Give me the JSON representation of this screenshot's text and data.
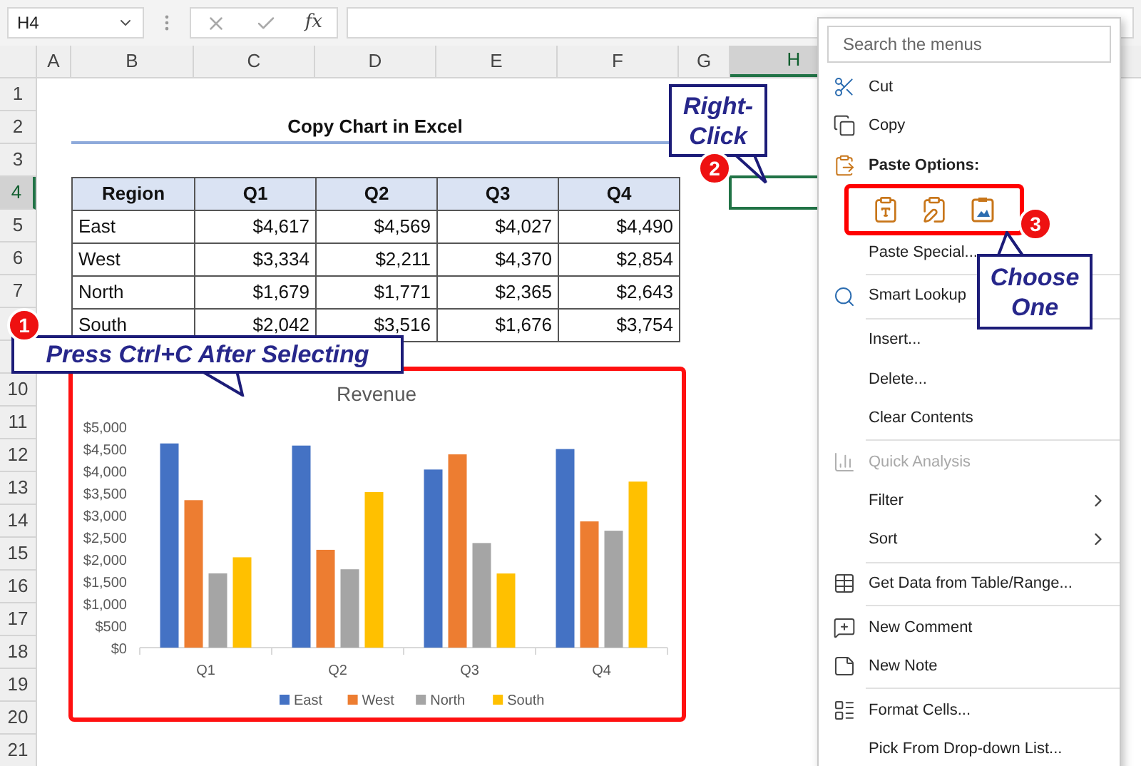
{
  "formula_bar": {
    "name_box": "H4",
    "function_label": "fx"
  },
  "columns": [
    {
      "label": "A",
      "selected": false
    },
    {
      "label": "B",
      "selected": false
    },
    {
      "label": "C",
      "selected": false
    },
    {
      "label": "D",
      "selected": false
    },
    {
      "label": "E",
      "selected": false
    },
    {
      "label": "F",
      "selected": false
    },
    {
      "label": "G",
      "selected": false
    },
    {
      "label": "H",
      "selected": true
    }
  ],
  "rows": [
    {
      "label": "1",
      "selected": false
    },
    {
      "label": "2",
      "selected": false
    },
    {
      "label": "3",
      "selected": false
    },
    {
      "label": "4",
      "selected": true
    },
    {
      "label": "5",
      "selected": false
    },
    {
      "label": "6",
      "selected": false
    },
    {
      "label": "7",
      "selected": false
    },
    {
      "selected": false
    },
    {
      "selected": false
    },
    {
      "label": "10",
      "selected": false
    },
    {
      "label": "11",
      "selected": false
    },
    {
      "label": "12",
      "selected": false
    },
    {
      "label": "13",
      "selected": false
    },
    {
      "label": "14",
      "selected": false
    },
    {
      "label": "15",
      "selected": false
    },
    {
      "label": "16",
      "selected": false
    },
    {
      "label": "17",
      "selected": false
    },
    {
      "label": "18",
      "selected": false
    },
    {
      "label": "19",
      "selected": false
    },
    {
      "label": "20",
      "selected": false
    },
    {
      "label": "21",
      "selected": false
    }
  ],
  "sheet": {
    "title": "Copy Chart in Excel",
    "table": {
      "columns": [
        "Region",
        "Q1",
        "Q2",
        "Q3",
        "Q4"
      ],
      "rows": [
        [
          "East",
          "$4,617",
          "$4,569",
          "$4,027",
          "$4,490"
        ],
        [
          "West",
          "$3,334",
          "$2,211",
          "$4,370",
          "$2,854"
        ],
        [
          "North",
          "$1,679",
          "$1,771",
          "$2,365",
          "$2,643"
        ],
        [
          "South",
          "$2,042",
          "$3,516",
          "$1,676",
          "$3,754"
        ]
      ]
    }
  },
  "chart": {
    "chart_data": {
      "type": "bar",
      "title": "Revenue",
      "categories": [
        "Q1",
        "Q2",
        "Q3",
        "Q4"
      ],
      "series": [
        {
          "name": "East",
          "color": "#4472c4",
          "values": [
            4617,
            4569,
            4027,
            4490
          ]
        },
        {
          "name": "West",
          "color": "#ed7d31",
          "values": [
            3334,
            2211,
            4370,
            2854
          ]
        },
        {
          "name": "North",
          "color": "#a5a5a5",
          "values": [
            1679,
            1771,
            2365,
            2643
          ]
        },
        {
          "name": "South",
          "color": "#ffc000",
          "values": [
            2042,
            3516,
            1676,
            3754
          ]
        }
      ],
      "legend": "bottom",
      "ylim": [
        0,
        5000
      ],
      "yticks": [
        {
          "value": 0,
          "label": "$0"
        },
        {
          "value": 500,
          "label": "$500"
        },
        {
          "value": 1000,
          "label": "$1,000"
        },
        {
          "value": 1500,
          "label": "$1,500"
        },
        {
          "value": 2000,
          "label": "$2,000"
        },
        {
          "value": 2500,
          "label": "$2,500"
        },
        {
          "value": 3000,
          "label": "$3,000"
        },
        {
          "value": 3500,
          "label": "$3,500"
        },
        {
          "value": 4000,
          "label": "$4,000"
        },
        {
          "value": 4500,
          "label": "$4,500"
        },
        {
          "value": 5000,
          "label": "$5,000"
        }
      ]
    }
  },
  "callouts": [
    {
      "number": "1",
      "text": "Press Ctrl+C After Selecting"
    },
    {
      "number": "2",
      "text": "Right-Click"
    },
    {
      "number": "3",
      "text": "Choose One"
    }
  ],
  "context_menu": {
    "search_placeholder": "Search the menus",
    "items": [
      {
        "kind": "item",
        "label": "Cut",
        "disabled": false,
        "submenu": false,
        "divider_after": false
      },
      {
        "kind": "item",
        "label": "Copy",
        "disabled": false,
        "submenu": false,
        "divider_after": false
      },
      {
        "kind": "header",
        "label": "Paste Options:"
      },
      {
        "kind": "paste_icons"
      },
      {
        "kind": "item",
        "label": "Paste Special...",
        "disabled": false,
        "submenu": false,
        "divider_after": true
      },
      {
        "kind": "item",
        "label": "Smart Lookup",
        "disabled": false,
        "submenu": false,
        "divider_after": true
      },
      {
        "kind": "item",
        "label": "Insert...",
        "disabled": false,
        "submenu": false,
        "divider_after": false
      },
      {
        "kind": "item",
        "label": "Delete...",
        "disabled": false,
        "submenu": false,
        "divider_after": false
      },
      {
        "kind": "item",
        "label": "Clear Contents",
        "disabled": false,
        "submenu": false,
        "divider_after": true
      },
      {
        "kind": "item",
        "label": "Quick Analysis",
        "disabled": true,
        "submenu": false,
        "divider_after": false
      },
      {
        "kind": "item",
        "label": "Filter",
        "disabled": false,
        "submenu": true,
        "divider_after": false
      },
      {
        "kind": "item",
        "label": "Sort",
        "disabled": false,
        "submenu": true,
        "divider_after": true
      },
      {
        "kind": "item",
        "label": "Get Data from Table/Range...",
        "disabled": false,
        "submenu": false,
        "divider_after": true
      },
      {
        "kind": "item",
        "label": "New Comment",
        "disabled": false,
        "submenu": false,
        "divider_after": false
      },
      {
        "kind": "item",
        "label": "New Note",
        "disabled": false,
        "submenu": false,
        "divider_after": true
      },
      {
        "kind": "item",
        "label": "Format Cells...",
        "disabled": false,
        "submenu": false,
        "divider_after": false
      },
      {
        "kind": "item",
        "label": "Pick From Drop-down List...",
        "disabled": false,
        "submenu": false,
        "divider_after": false
      }
    ]
  }
}
